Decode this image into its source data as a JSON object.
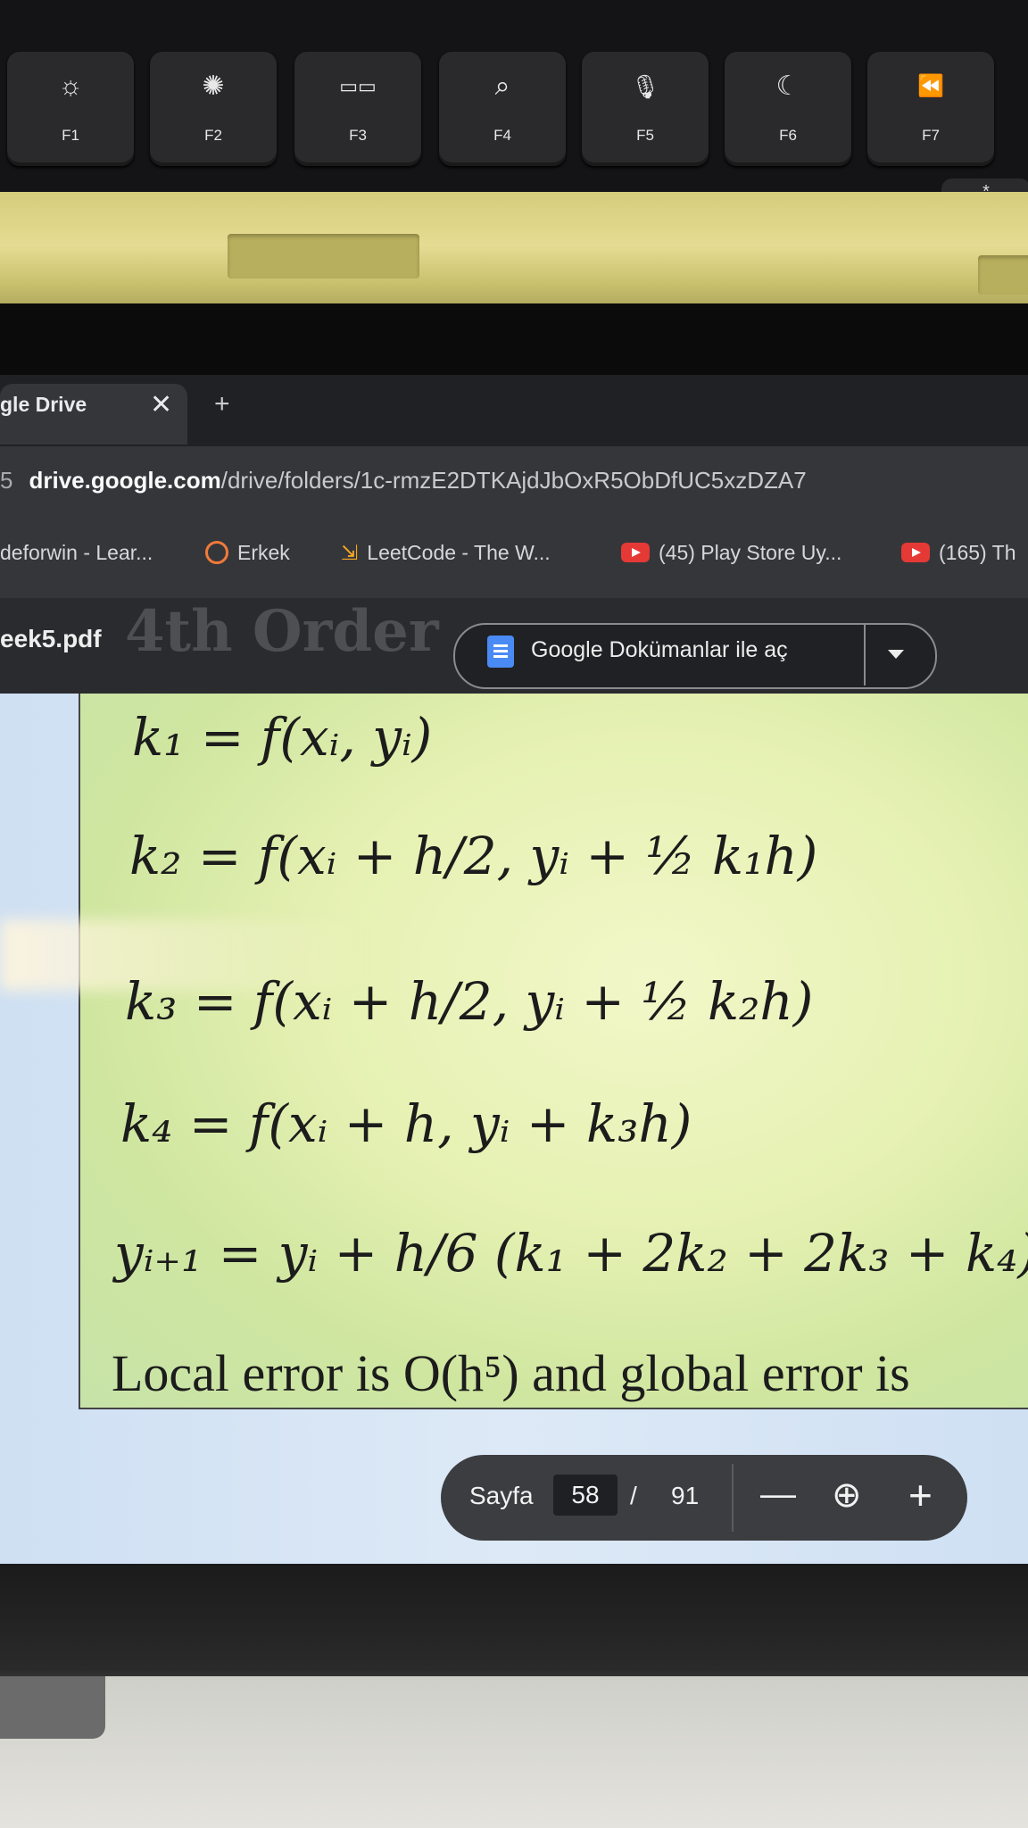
{
  "keyboard": {
    "keys": [
      {
        "label": "F1",
        "icon": "brightness-low-icon",
        "glyph": "☼"
      },
      {
        "label": "F2",
        "icon": "brightness-high-icon",
        "glyph": "✺"
      },
      {
        "label": "F3",
        "icon": "mission-control-icon",
        "glyph": "▭▭"
      },
      {
        "label": "F4",
        "icon": "search-icon",
        "glyph": "⌕"
      },
      {
        "label": "F5",
        "icon": "microphone-icon",
        "glyph": "🎙"
      },
      {
        "label": "F6",
        "icon": "moon-icon",
        "glyph": "☾"
      },
      {
        "label": "F7",
        "icon": "rewind-icon",
        "glyph": "⏪"
      }
    ],
    "star_key": "*"
  },
  "browser": {
    "tab_title": "gle Drive",
    "close_glyph": "✕",
    "new_tab_glyph": "+",
    "url_prefix": "5",
    "url_host": "drive.google.com",
    "url_path": "/drive/folders/1c-rmzE2DTKAjdJbOxR5ObDfUC5xzDZA7",
    "bookmarks": [
      {
        "label": "deforwin - Lear...",
        "icon": "none"
      },
      {
        "label": "Erkek",
        "icon": "erkek-icon"
      },
      {
        "label": "LeetCode - The W...",
        "icon": "leetcode-icon"
      },
      {
        "label": "(45) Play Store Uy...",
        "icon": "youtube-icon"
      },
      {
        "label": "(165) Th",
        "icon": "youtube-icon"
      }
    ]
  },
  "pdf": {
    "filename": "eek5.pdf",
    "heading_partial": "4th Order",
    "open_with_label": "Google Dokümanlar ile aç",
    "equations": {
      "k1": "k₁ = f(xᵢ, yᵢ)",
      "k2": "k₂ = f(xᵢ + h/2,  yᵢ + ½ k₁h)",
      "k3": "k₃ = f(xᵢ + h/2,  yᵢ + ½ k₂h)",
      "k4": "k₄ = f(xᵢ + h,  yᵢ + k₃h)",
      "y_next": "yᵢ₊₁ = yᵢ + h/6 (k₁ + 2k₂ + 2k₃ + k₄)",
      "local_error": "Local error is O(h⁵) and global error is"
    },
    "pager": {
      "label": "Sayfa",
      "current": "58",
      "separator": "/",
      "total": "91"
    }
  },
  "colors": {
    "browser_dark": "#35363a",
    "tab_bar": "#1f2124",
    "page_green": "#e6f1b3",
    "page_bg_blue": "#cfe0f3",
    "docs_blue": "#4a8af4",
    "youtube_red": "#e53935"
  }
}
